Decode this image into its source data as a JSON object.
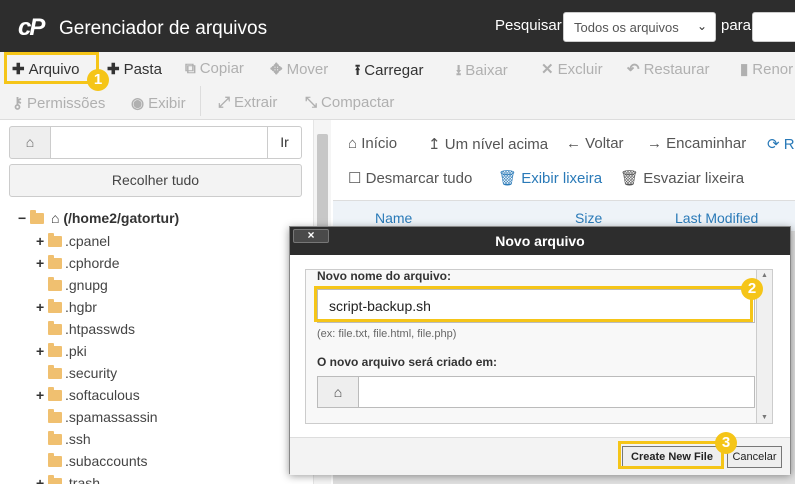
{
  "header": {
    "logo": "cP",
    "title": "Gerenciador de arquivos",
    "search_label": "Pesquisar",
    "search_scope": "Todos os arquivos",
    "para_label": "para"
  },
  "toolbar": {
    "row1": [
      "Arquivo",
      "Pasta",
      "Copiar",
      "Mover",
      "Carregar",
      "Baixar",
      "Excluir",
      "Restaurar",
      "Renor"
    ],
    "row2": [
      "Permissões",
      "Exibir",
      "Extrair",
      "Compactar"
    ]
  },
  "left": {
    "go_label": "Ir",
    "collapse_label": "Recolher tudo",
    "root": "(/home2/gatortur)",
    "items": [
      ".cpanel",
      ".cphorde",
      ".gnupg",
      ".hgbr",
      ".htpasswds",
      ".pki",
      ".security",
      ".softaculous",
      ".spamassassin",
      ".ssh",
      ".subaccounts",
      ".trash"
    ]
  },
  "right": {
    "nav": [
      "Início",
      "Um nível acima",
      "Voltar",
      "Encaminhar",
      "R"
    ],
    "actions": [
      "Desmarcar tudo",
      "Exibir lixeira",
      "Esvaziar lixeira"
    ],
    "columns": [
      "Name",
      "Size",
      "Last Modified"
    ]
  },
  "modal": {
    "title": "Novo arquivo",
    "close_label": "×",
    "name_label": "Novo nome do arquivo:",
    "name_value": "script-backup.sh",
    "hint": "(ex: file.txt, file.html, file.php)",
    "dir_label": "O novo arquivo será criado em:",
    "create_label": "Create New File",
    "cancel_label": "Cancelar"
  },
  "badges": [
    "1",
    "2",
    "3"
  ],
  "colors": {
    "highlight": "#f5c518",
    "header": "#2d2d2d",
    "link": "#2a7ab8"
  }
}
